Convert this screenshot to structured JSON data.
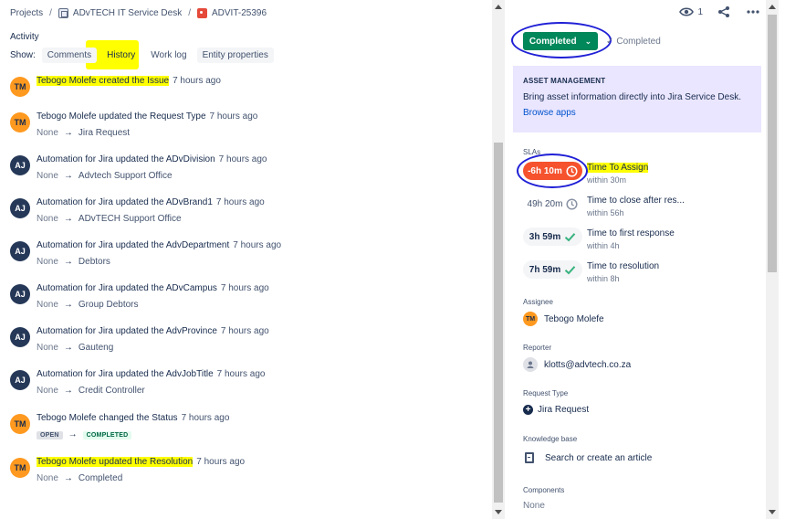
{
  "breadcrumbs": [
    {
      "label": "Projects"
    },
    {
      "label": "ADvTECH IT Service Desk",
      "icon": "service-desk-icon"
    },
    {
      "label": "ADVIT-25396",
      "icon": "issue-type-icon"
    }
  ],
  "activity": {
    "title": "Activity",
    "show_label": "Show:",
    "filters": [
      "Comments",
      "History",
      "Work log",
      "Entity properties"
    ],
    "active_filter": "History"
  },
  "entries": [
    {
      "initials": "TM",
      "text": "Tebogo Molefe created the Issue",
      "time": "7 hours ago",
      "from": "",
      "to": "",
      "highlight": true
    },
    {
      "initials": "TM",
      "text": "Tebogo Molefe updated the Request Type",
      "time": "7 hours ago",
      "from": "None",
      "to": "Jira Request"
    },
    {
      "initials": "AJ",
      "text": "Automation for Jira updated the ADvDivision",
      "time": "7 hours ago",
      "from": "None",
      "to": "Advtech Support Office"
    },
    {
      "initials": "AJ",
      "text": "Automation for Jira updated the ADvBrand1",
      "time": "7 hours ago",
      "from": "None",
      "to": "ADvTECH Support Office"
    },
    {
      "initials": "AJ",
      "text": "Automation for Jira updated the AdvDepartment",
      "time": "7 hours ago",
      "from": "None",
      "to": "Debtors"
    },
    {
      "initials": "AJ",
      "text": "Automation for Jira updated the ADvCampus",
      "time": "7 hours ago",
      "from": "None",
      "to": "Group Debtors"
    },
    {
      "initials": "AJ",
      "text": "Automation for Jira updated the AdvProvince",
      "time": "7 hours ago",
      "from": "None",
      "to": "Gauteng"
    },
    {
      "initials": "AJ",
      "text": "Automation for Jira updated the AdvJobTitle",
      "time": "7 hours ago",
      "from": "None",
      "to": "Credit Controller"
    },
    {
      "initials": "TM",
      "text": "Tebogo Molefe changed the Status",
      "time": "7 hours ago",
      "from": "OPEN",
      "to": "COMPLETED"
    },
    {
      "initials": "TM",
      "text": "Tebogo Molefe updated the Resolution",
      "time": "7 hours ago",
      "from": "None",
      "to": "Completed",
      "highlight": true
    }
  ],
  "header": {
    "watchers": "1",
    "status_button": "Completed",
    "status_text": "Completed"
  },
  "asset": {
    "heading": "ASSET MANAGEMENT",
    "description": "Bring asset information directly into Jira Service Desk.",
    "link": "Browse apps"
  },
  "slas_label": "SLAs",
  "slas": [
    {
      "value": "-6h 10m",
      "title": "Time To Assign",
      "within": "within 30m",
      "state": "breached",
      "icon": "clock-icon"
    },
    {
      "value": "49h 20m",
      "title": "Time to close after res...",
      "within": "within 56h",
      "state": "paused",
      "icon": "clock-icon"
    },
    {
      "value": "3h 59m",
      "title": "Time to first response",
      "within": "within 4h",
      "state": "met",
      "icon": "check-icon"
    },
    {
      "value": "7h 59m",
      "title": "Time to resolution",
      "within": "within 8h",
      "state": "met",
      "icon": "check-icon"
    }
  ],
  "fields": {
    "assignee_label": "Assignee",
    "assignee": "Tebogo Molefe",
    "assignee_initials": "TM",
    "reporter_label": "Reporter",
    "reporter": "klotts@advtech.co.za",
    "request_type_label": "Request Type",
    "request_type": "Jira Request",
    "kb_label": "Knowledge base",
    "kb_action": "Search or create an article",
    "components_label": "Components",
    "components": "None"
  },
  "colors": {
    "accent": "#0052cc",
    "status_green": "#00875a",
    "breach_red": "#f5522d",
    "highlight": "#ffff00",
    "annotation_blue": "#1f1fd6"
  }
}
